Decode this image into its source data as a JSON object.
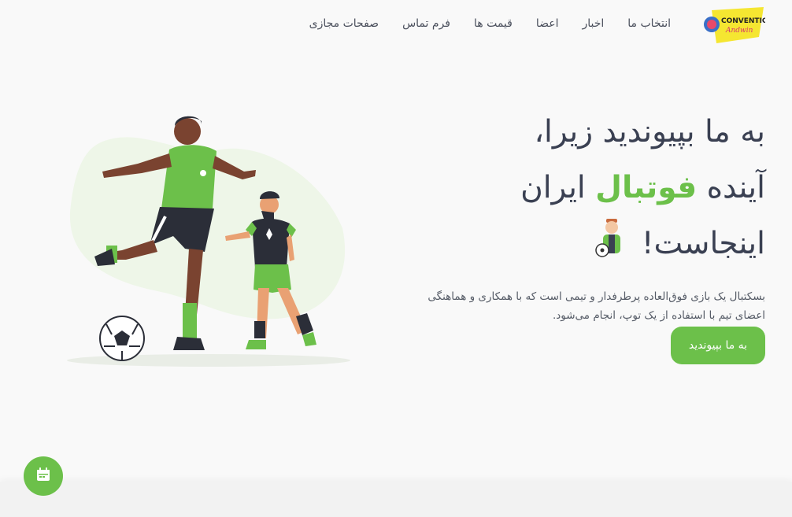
{
  "logo": {
    "alt_text": "CONVENTION"
  },
  "nav": {
    "items": [
      {
        "label": "انتخاب ما"
      },
      {
        "label": "اخبار"
      },
      {
        "label": "اعضا"
      },
      {
        "label": "قیمت ها"
      },
      {
        "label": "فرم تماس"
      },
      {
        "label": "صفحات مجازی"
      }
    ]
  },
  "hero": {
    "line1": "به ما بپیوندید زیرا،",
    "line2_before": "آینده",
    "line2_accent": "فوتبال",
    "line2_after": "ایران",
    "line3": "اینجاست!",
    "description": "بسکتبال یک بازی فوق‌العاده پرطرفدار و تیمی است که با همکاری و هماهنگی اعضای تیم با استفاده از یک توپ، انجام می‌شود.",
    "cta_label": "به ما بپیوندید"
  },
  "colors": {
    "accent": "#6cc04a",
    "text": "#3a4052",
    "background": "#f9f9f9"
  },
  "icons": {
    "calendar": "calendar-icon"
  }
}
